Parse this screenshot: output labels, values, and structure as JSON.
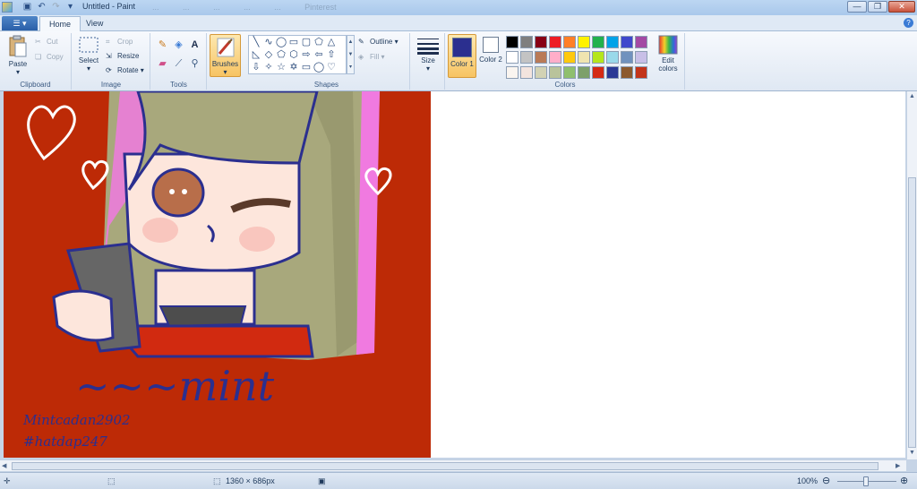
{
  "window": {
    "title": "Untitled - Paint",
    "background_tabs": [
      "...",
      "...",
      "...",
      "...",
      "...",
      "Pinterest"
    ]
  },
  "menu": {
    "file_label": "☰ ▾",
    "tabs": [
      {
        "label": "Home",
        "active": true
      },
      {
        "label": "View",
        "active": false
      }
    ],
    "help": "?"
  },
  "ribbon": {
    "clipboard": {
      "label": "Clipboard",
      "paste": "Paste",
      "cut": "Cut",
      "copy": "Copy"
    },
    "image": {
      "label": "Image",
      "select": "Select",
      "crop": "Crop",
      "resize": "Resize",
      "rotate": "Rotate"
    },
    "tools": {
      "label": "Tools"
    },
    "brushes": {
      "label": "Brushes"
    },
    "shapes": {
      "label": "Shapes",
      "outline": "Outline",
      "fill": "Fill"
    },
    "size": {
      "label": "Size"
    },
    "colors": {
      "label": "Colors",
      "color1_label": "Color 1",
      "color2_label": "Color 2",
      "color1_value": "#2b2f8f",
      "color2_value": "#ffffff",
      "edit_colors": "Edit colors",
      "palette": [
        "#000000",
        "#7f7f7f",
        "#880015",
        "#ed1c24",
        "#ff7f27",
        "#fff200",
        "#22b14c",
        "#00a2e8",
        "#3f48cc",
        "#a349a4",
        "#ffffff",
        "#c3c3c3",
        "#b97a57",
        "#ffaec9",
        "#ffc90e",
        "#efe4b0",
        "#b5e61d",
        "#99d9ea",
        "#7092be",
        "#c8bfe7",
        "#faf5f0",
        "#f3e4de",
        "#d2d2b4",
        "#b9c39b",
        "#8fbf6e",
        "#7da06a",
        "#d42a14",
        "#2a3a96",
        "#8c5a2e",
        "#c3341a"
      ]
    }
  },
  "canvas": {
    "background_color": "#bd2a06",
    "signature_lines": [
      "Mintcadan2902",
      "#hatdap247"
    ],
    "logo_text": "mint"
  },
  "status": {
    "dimensions": "1360 × 686px",
    "zoom": "100%"
  }
}
